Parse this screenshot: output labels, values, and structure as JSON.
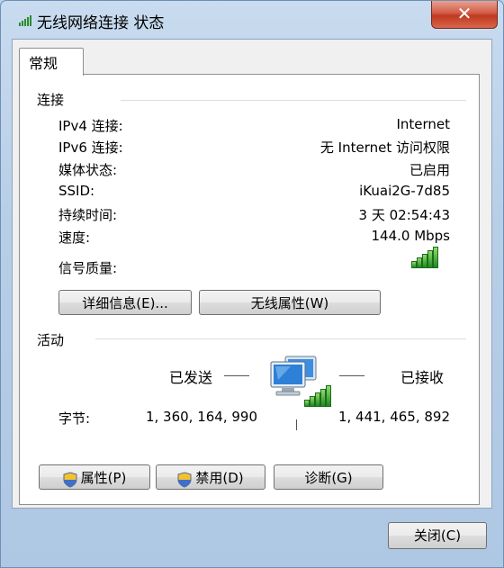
{
  "window": {
    "title": "无线网络连接 状态",
    "close_glyph": "✕"
  },
  "tabs": [
    {
      "label": "常规"
    }
  ],
  "connection": {
    "heading": "连接",
    "rows": [
      {
        "label": "IPv4 连接:",
        "value": "Internet"
      },
      {
        "label": "IPv6 连接:",
        "value": "无 Internet 访问权限"
      },
      {
        "label": "媒体状态:",
        "value": "已启用"
      },
      {
        "label": "SSID:",
        "value": "iKuai2G-7d85"
      },
      {
        "label": "持续时间:",
        "value": "3 天 02:54:43"
      },
      {
        "label": "速度:",
        "value": "144.0 Mbps"
      }
    ],
    "signal_label": "信号质量:",
    "signal_icon": "signal-strength-icon",
    "signal_bars": 5,
    "signal_bars_max": 5,
    "details_button": "详细信息(E)...",
    "wireless_props_button": "无线属性(W)"
  },
  "activity": {
    "heading": "活动",
    "sent_label": "已发送",
    "received_label": "已接收",
    "bytes_label": "字节:",
    "bytes_sent": "1, 360, 164, 990",
    "bytes_received": "1, 441, 465, 892",
    "network_icon": "network-computer-icon"
  },
  "buttons": {
    "properties": "属性(P)",
    "disable": "禁用(D)",
    "diagnose": "诊断(G)",
    "close": "关闭(C)"
  },
  "colors": {
    "title_close_red": "#c0391f",
    "signal_green": "#1f8a1f",
    "window_blue": "#b9d1ea"
  }
}
